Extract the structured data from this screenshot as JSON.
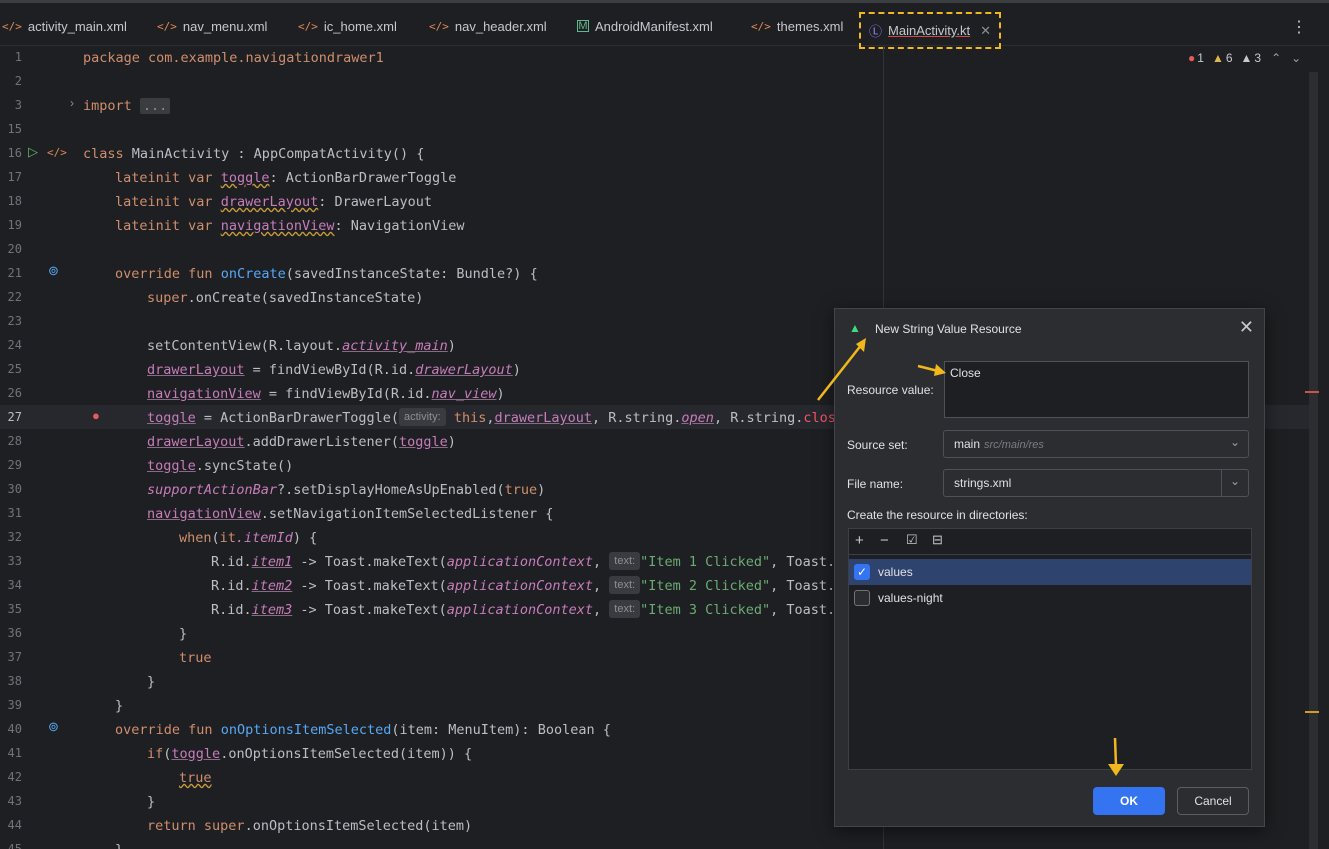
{
  "tabs": [
    {
      "label": "activity_main.xml",
      "icon": "xml-icon"
    },
    {
      "label": "nav_menu.xml",
      "icon": "xml-icon"
    },
    {
      "label": "ic_home.xml",
      "icon": "xml-icon"
    },
    {
      "label": "nav_header.xml",
      "icon": "xml-icon"
    },
    {
      "label": "AndroidManifest.xml",
      "icon": "manifest-icon"
    },
    {
      "label": "themes.xml",
      "icon": "xml-icon"
    },
    {
      "label": "MainActivity.kt",
      "icon": "kotlin-class-icon",
      "active": true
    }
  ],
  "problems": {
    "errors": "1",
    "warnings": "6",
    "weak_warnings": "3"
  },
  "code": {
    "l1": "package com.example.navigationdrawer1",
    "l3_kw": "import",
    "l3_fold": "...",
    "l16_kw": "class",
    "l16_rest": " MainActivity : AppCompatActivity() {",
    "lateinit": "lateinit",
    "var": "var",
    "toggle": "toggle",
    "drawerLayout": "drawerLayout",
    "navigationView": "navigationView",
    "l17_type": ": ActionBarDrawerToggle",
    "l18_type": ": DrawerLayout",
    "l19_type": ": NavigationView",
    "override": "override",
    "fun": "fun",
    "onCreate": "onCreate",
    "l21_rest": "(savedInstanceState: Bundle?) {",
    "super": "super",
    "l22_rest": ".onCreate(savedInstanceState)",
    "l24_a": "setContentView(R.layout.",
    "activity_main": "activity_main",
    "close_paren": ")",
    "l25_a": " = findViewById(R.id.",
    "nav_view": "nav_view",
    "l27_a": " = ActionBarDrawerToggle(",
    "hint_activity": "activity:",
    "this": "this",
    "comma": ",",
    "l27_b": ", R.string.",
    "open": "open",
    "close": "close",
    "l28_a": ".addDrawerListener(",
    "l28_b": ")",
    "l29_a": ".syncState()",
    "supportActionBar": "supportActionBar",
    "l30_a": "?.setDisplayHomeAsUpEnabled(",
    "true": "true",
    "l31_a": ".setNavigationItemSelectedListener {",
    "when": "when",
    "l32_a": "(",
    "it": "it",
    "itemId": ".itemId",
    "l32_b": ") {",
    "rid": "R.id.",
    "item1": "item1",
    "item2": "item2",
    "item3": "item3",
    "toast_a": " -> Toast.makeText(",
    "applicationContext": "applicationContext",
    "hint_text": "text:",
    "s1": "\"Item 1 Clicked\"",
    "s2": "\"Item 2 Clicked\"",
    "s3": "\"Item 3 Clicked\"",
    "toast_b": ", Toast.",
    "rbrace": "}",
    "onOptionsItemSelected": "onOptionsItemSelected",
    "l40_rest": "(item: MenuItem): Boolean {",
    "if": "if",
    "l41_a": "(",
    "l41_b": ".onOptionsItemSelected(item)) {",
    "return": "return",
    "l44_rest": ".onOptionsItemSelected(item)",
    "comma_sp": ", "
  },
  "line_numbers": [
    "1",
    "2",
    "3",
    "15",
    "16",
    "17",
    "18",
    "19",
    "20",
    "21",
    "22",
    "23",
    "24",
    "25",
    "26",
    "27",
    "28",
    "29",
    "30",
    "31",
    "32",
    "33",
    "34",
    "35",
    "36",
    "37",
    "38",
    "39",
    "40",
    "41",
    "42",
    "43",
    "44",
    "45"
  ],
  "dialog": {
    "title": "New String Value Resource",
    "resource_value_label": "Resource value:",
    "resource_value": "Close",
    "source_set_label": "Source set:",
    "source_set_value": "main",
    "source_set_path": "src/main/res",
    "file_name_label": "File name:",
    "file_name_value": "strings.xml",
    "directories_label": "Create the resource in directories:",
    "directories": [
      {
        "name": "values",
        "checked": true
      },
      {
        "name": "values-night",
        "checked": false
      }
    ],
    "ok_label": "OK",
    "cancel_label": "Cancel"
  },
  "colors": {
    "accent": "#3574f0",
    "annotation": "#f0b81c",
    "error": "#e55b5b",
    "warning": "#e2b64f"
  }
}
